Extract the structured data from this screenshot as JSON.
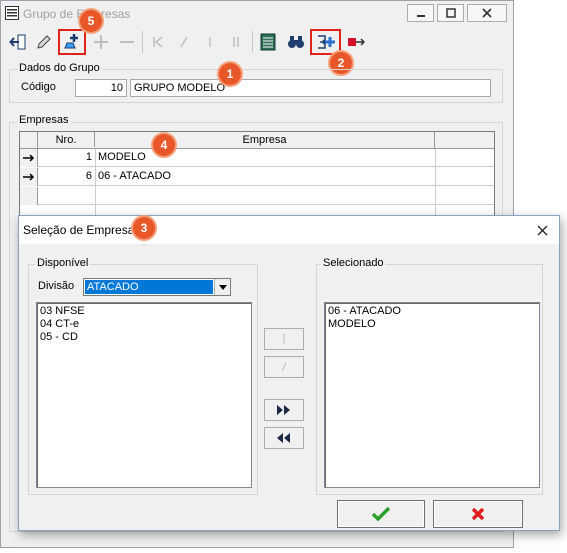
{
  "window": {
    "title": "Grupo de Empresas"
  },
  "dados_grupo": {
    "legend": "Dados do Grupo",
    "codigo_label": "Código",
    "codigo_value": "10",
    "nome_value": "GRUPO MODELO"
  },
  "empresas": {
    "legend": "Empresas",
    "col_nro": "Nro.",
    "col_empresa": "Empresa",
    "rows": [
      {
        "nro": "1",
        "empresa": "MODELO"
      },
      {
        "nro": "6",
        "empresa": "06 - ATACADO"
      }
    ]
  },
  "dialog": {
    "title": "Seleção de Empresa",
    "disponivel_legend": "Disponível",
    "divisao_label": "Divisão",
    "divisao_value": "ATACADO",
    "disponivel_items": [
      "03 NFSE",
      "04 CT-e",
      "05 - CD"
    ],
    "selecionado_legend": "Selecionado",
    "selecionado_items": [
      "06 - ATACADO",
      "MODELO"
    ]
  },
  "badges": [
    "1",
    "2",
    "3",
    "4",
    "5"
  ],
  "colors": {
    "badge": "#e8572a",
    "highlight": "#e0241c",
    "selection": "#0078d7",
    "ok": "#2ea02e",
    "cancel": "#e01e1e"
  }
}
